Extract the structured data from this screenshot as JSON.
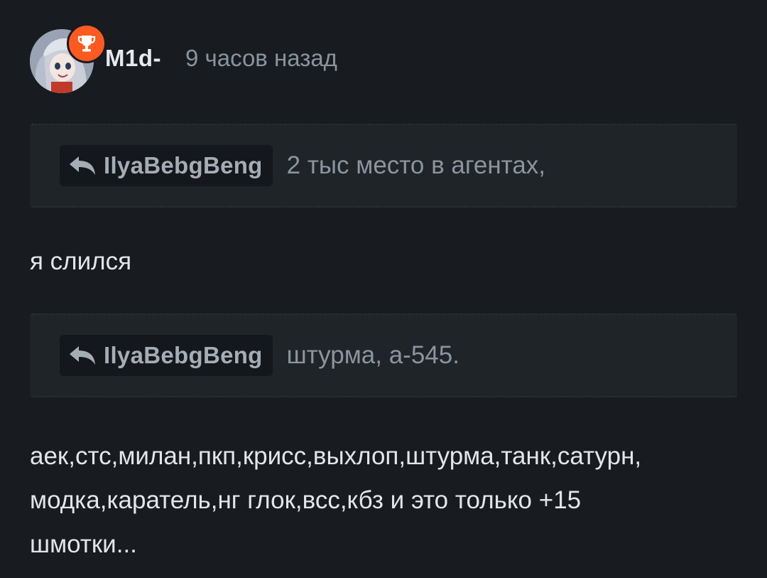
{
  "post": {
    "author": "M1d-",
    "time": "9 часов назад",
    "avatar_icon": "anime-avatar",
    "badge_icon": "trophy-icon",
    "badge_color": "#ff5a1f"
  },
  "quotes": [
    {
      "author": "IlyaBebgBeng",
      "text": "2 тыс место в агентах,"
    },
    {
      "author": "IlyaBebgBeng",
      "text": "штурма, а-545."
    }
  ],
  "messages": [
    {
      "lines": [
        "я слился"
      ]
    },
    {
      "lines": [
        "аек,стс,милан,пкп,крисс,выхлоп,штурма,танк,сатурн,",
        "модка,каратель,нг глок,всс,кбз и это только +15",
        "шмотки..."
      ]
    }
  ]
}
